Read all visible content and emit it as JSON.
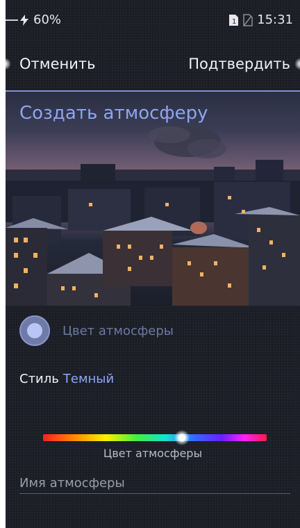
{
  "status_bar": {
    "battery": "60%",
    "time": "15:31"
  },
  "action_bar": {
    "cancel_label": "Отменить",
    "confirm_label": "Подтвердить"
  },
  "hero": {
    "title": "Создать атмосферу"
  },
  "atmosphere_color": {
    "label": "Цвет атмосферы",
    "swatch_color": "#b8c6f6"
  },
  "style": {
    "label": "Стиль",
    "value": "Темный"
  },
  "color_slider": {
    "label": "Цвет атмосферы",
    "position": 0.62
  },
  "name_field": {
    "placeholder": "Имя атмосферы",
    "value": ""
  },
  "colors": {
    "accent": "#8ea6ee",
    "background": "#1b1e26"
  }
}
